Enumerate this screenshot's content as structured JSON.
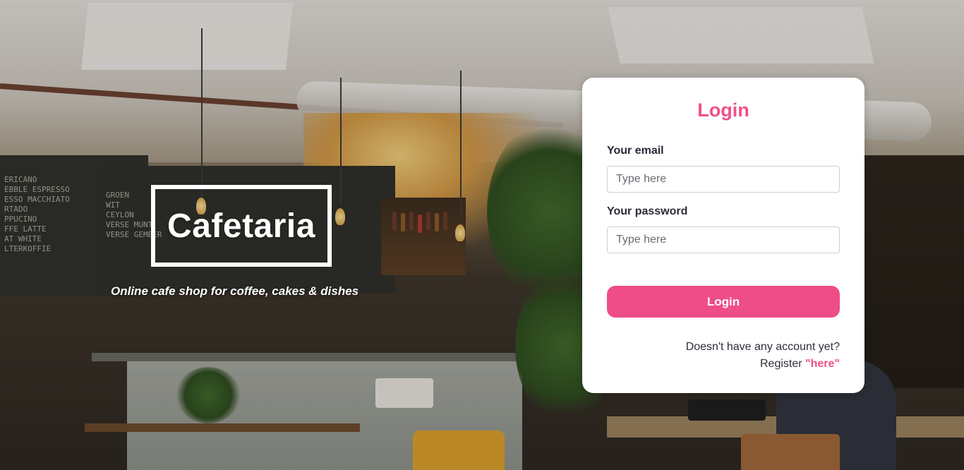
{
  "brand": {
    "title": "Cafetaria",
    "tagline": "Online cafe shop for coffee, cakes & dishes"
  },
  "login": {
    "title": "Login",
    "email_label": "Your email",
    "email_placeholder": "Type here",
    "password_label": "Your password",
    "password_placeholder": "Type here",
    "submit_label": "Login",
    "no_account_text": "Doesn't have any account yet?",
    "register_prefix": "Register",
    "register_link": "\"here\""
  },
  "colors": {
    "accent": "#ee4d88",
    "card_bg": "#ffffff",
    "text_dark": "#2b2b3a"
  }
}
